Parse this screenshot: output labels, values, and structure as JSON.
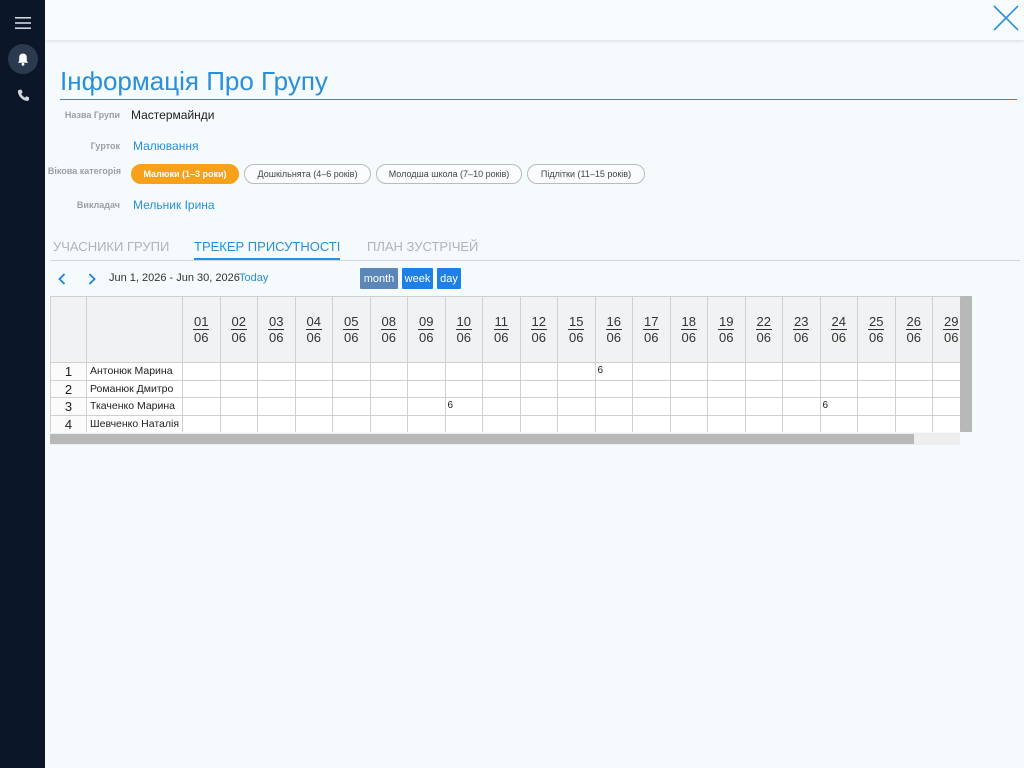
{
  "colors": {
    "accent": "#2a8fdb",
    "active_chip": "#f7a11a",
    "sidebar": "#0b1729"
  },
  "nav": {
    "icons": [
      "menu-icon",
      "bell-icon",
      "phone-icon"
    ]
  },
  "page_title": "Інформація Про Групу",
  "fields": {
    "group_name_label": "Назва Групи",
    "group_name_value": "Мастермайнди",
    "club_label": "Гурток",
    "club_value": "Малювання",
    "age_label": "Вікова категорія",
    "teacher_label": "Викладач",
    "teacher_value": "Мельник Ірина"
  },
  "age_chips": [
    {
      "label": "Малюки (1–3 роки)",
      "active": true
    },
    {
      "label": "Дошкільнята (4–6 років)",
      "active": false
    },
    {
      "label": "Молодша школа (7–10 років)",
      "active": false
    },
    {
      "label": "Підлітки (11–15 років)",
      "active": false
    }
  ],
  "tabs": [
    {
      "label": "УЧАСНИКИ ГРУПИ",
      "active": false
    },
    {
      "label": "ТРЕКЕР ПРИСУТНОСТІ",
      "active": true
    },
    {
      "label": "ПЛАН ЗУСТРІЧЕЙ",
      "active": false
    }
  ],
  "calendar": {
    "range": "Jun 1, 2026 - Jun 30, 2026",
    "today": "Today",
    "views": [
      "month",
      "week",
      "day"
    ]
  },
  "dates": [
    {
      "day": "01",
      "mon": "06"
    },
    {
      "day": "02",
      "mon": "06"
    },
    {
      "day": "03",
      "mon": "06"
    },
    {
      "day": "04",
      "mon": "06"
    },
    {
      "day": "05",
      "mon": "06"
    },
    {
      "day": "08",
      "mon": "06"
    },
    {
      "day": "09",
      "mon": "06"
    },
    {
      "day": "10",
      "mon": "06"
    },
    {
      "day": "11",
      "mon": "06"
    },
    {
      "day": "12",
      "mon": "06"
    },
    {
      "day": "15",
      "mon": "06"
    },
    {
      "day": "16",
      "mon": "06"
    },
    {
      "day": "17",
      "mon": "06"
    },
    {
      "day": "18",
      "mon": "06"
    },
    {
      "day": "19",
      "mon": "06"
    },
    {
      "day": "22",
      "mon": "06"
    },
    {
      "day": "23",
      "mon": "06"
    },
    {
      "day": "24",
      "mon": "06"
    },
    {
      "day": "25",
      "mon": "06"
    },
    {
      "day": "26",
      "mon": "06"
    },
    {
      "day": "29",
      "mon": "06"
    }
  ],
  "students": [
    {
      "idx": "1",
      "name": "Антонюк Марина",
      "marks": [
        "",
        "",
        "",
        "",
        "",
        "",
        "",
        "",
        "",
        "",
        "",
        "6",
        "",
        "",
        "",
        "",
        "",
        "",
        "",
        "",
        ""
      ]
    },
    {
      "idx": "2",
      "name": "Романюк Дмитро",
      "marks": [
        "",
        "",
        "",
        "",
        "",
        "",
        "",
        "",
        "",
        "",
        "",
        "",
        "",
        "",
        "",
        "",
        "",
        "",
        "",
        "",
        ""
      ]
    },
    {
      "idx": "3",
      "name": "Ткаченко Марина",
      "marks": [
        "",
        "",
        "",
        "",
        "",
        "",
        "",
        "6",
        "",
        "",
        "",
        "",
        "",
        "",
        "",
        "",
        "",
        "6",
        "",
        "",
        ""
      ]
    },
    {
      "idx": "4",
      "name": "Шевченко Наталія",
      "marks": [
        "",
        "",
        "",
        "",
        "",
        "",
        "",
        "",
        "",
        "",
        "",
        "",
        "",
        "",
        "",
        "",
        "",
        "",
        "",
        "",
        ""
      ]
    }
  ]
}
